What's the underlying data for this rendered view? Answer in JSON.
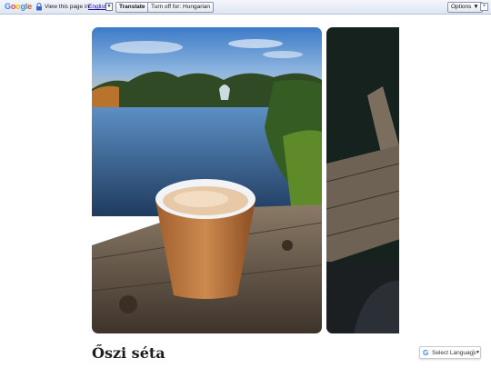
{
  "translate_bar": {
    "logo_text": "Google",
    "view_prefix": "View this page in:",
    "language": "English",
    "translate_label": "Translate",
    "turn_off_label": "Turn off for: Hungarian",
    "options_label": "Options ▼",
    "close_label": "×",
    "icons": [
      "lock-icon",
      "dropdown-arrow-icon",
      "close-icon"
    ]
  },
  "gallery": {
    "slides": [
      {
        "alt": "Coffee cup on a wooden railing by a lake with a fountain"
      },
      {
        "alt": "Wooden railing in the dark"
      }
    ]
  },
  "post": {
    "title": "Őszi séta"
  },
  "language_selector": {
    "g_icon": "G",
    "label": "Select Language",
    "arrow": "▼"
  },
  "colors": {
    "accent": "#4285f4",
    "link": "#1a0dab",
    "bar_background": "#dfe6f2"
  }
}
